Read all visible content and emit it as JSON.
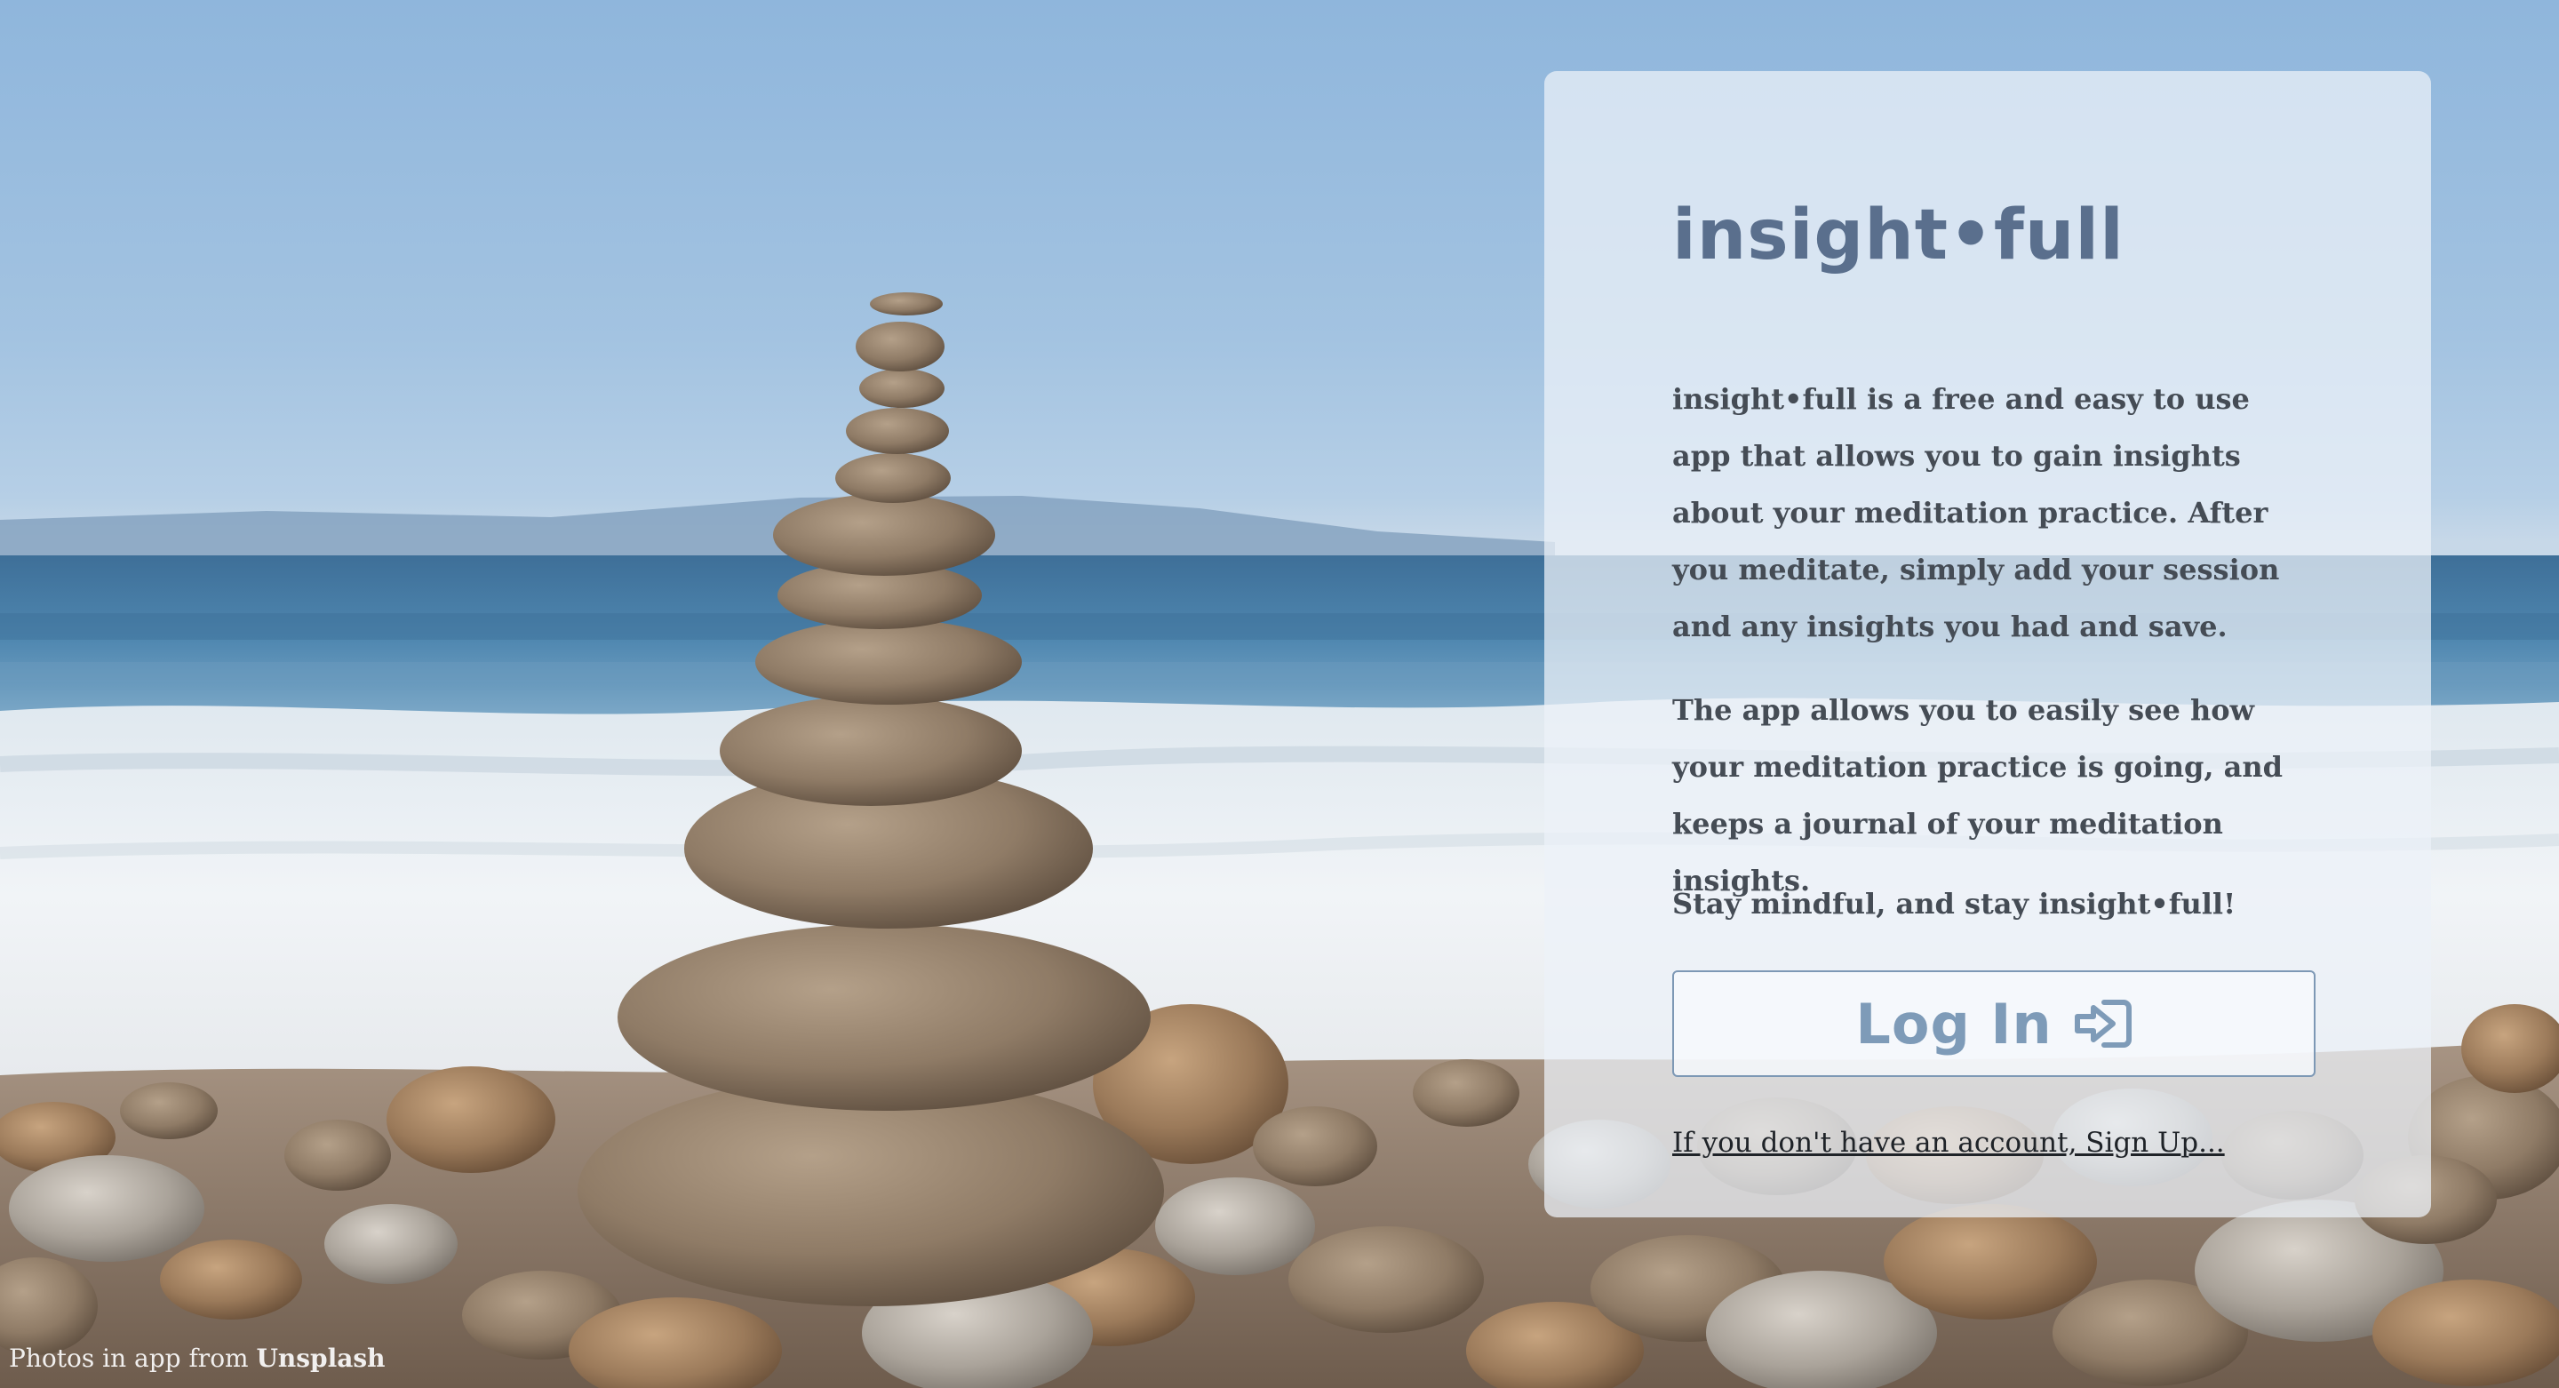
{
  "app": {
    "title": "insight•full"
  },
  "intro": {
    "paragraph_1": "insight•full is a free and easy to use app that allows you to gain insights about your meditation practice. After you meditate, simply add your session and any insights you had and save.",
    "paragraph_2": "The app allows you to easily see how your meditation practice is going, and keeps a journal of your meditation insights.",
    "paragraph_3": "Stay mindful, and stay insight•full!"
  },
  "login_button": {
    "label": "Log In",
    "icon": "sign-in-icon"
  },
  "signup_link": {
    "text": "If you don't have an account, Sign Up..."
  },
  "footer": {
    "credit_prefix": "Photos in app from ",
    "credit_brand": "Unsplash"
  },
  "colors": {
    "title": "#5a6f8d",
    "body_text": "#454c55",
    "button_accent": "#7e9bb8",
    "panel_bg": "#ecf2f8"
  }
}
